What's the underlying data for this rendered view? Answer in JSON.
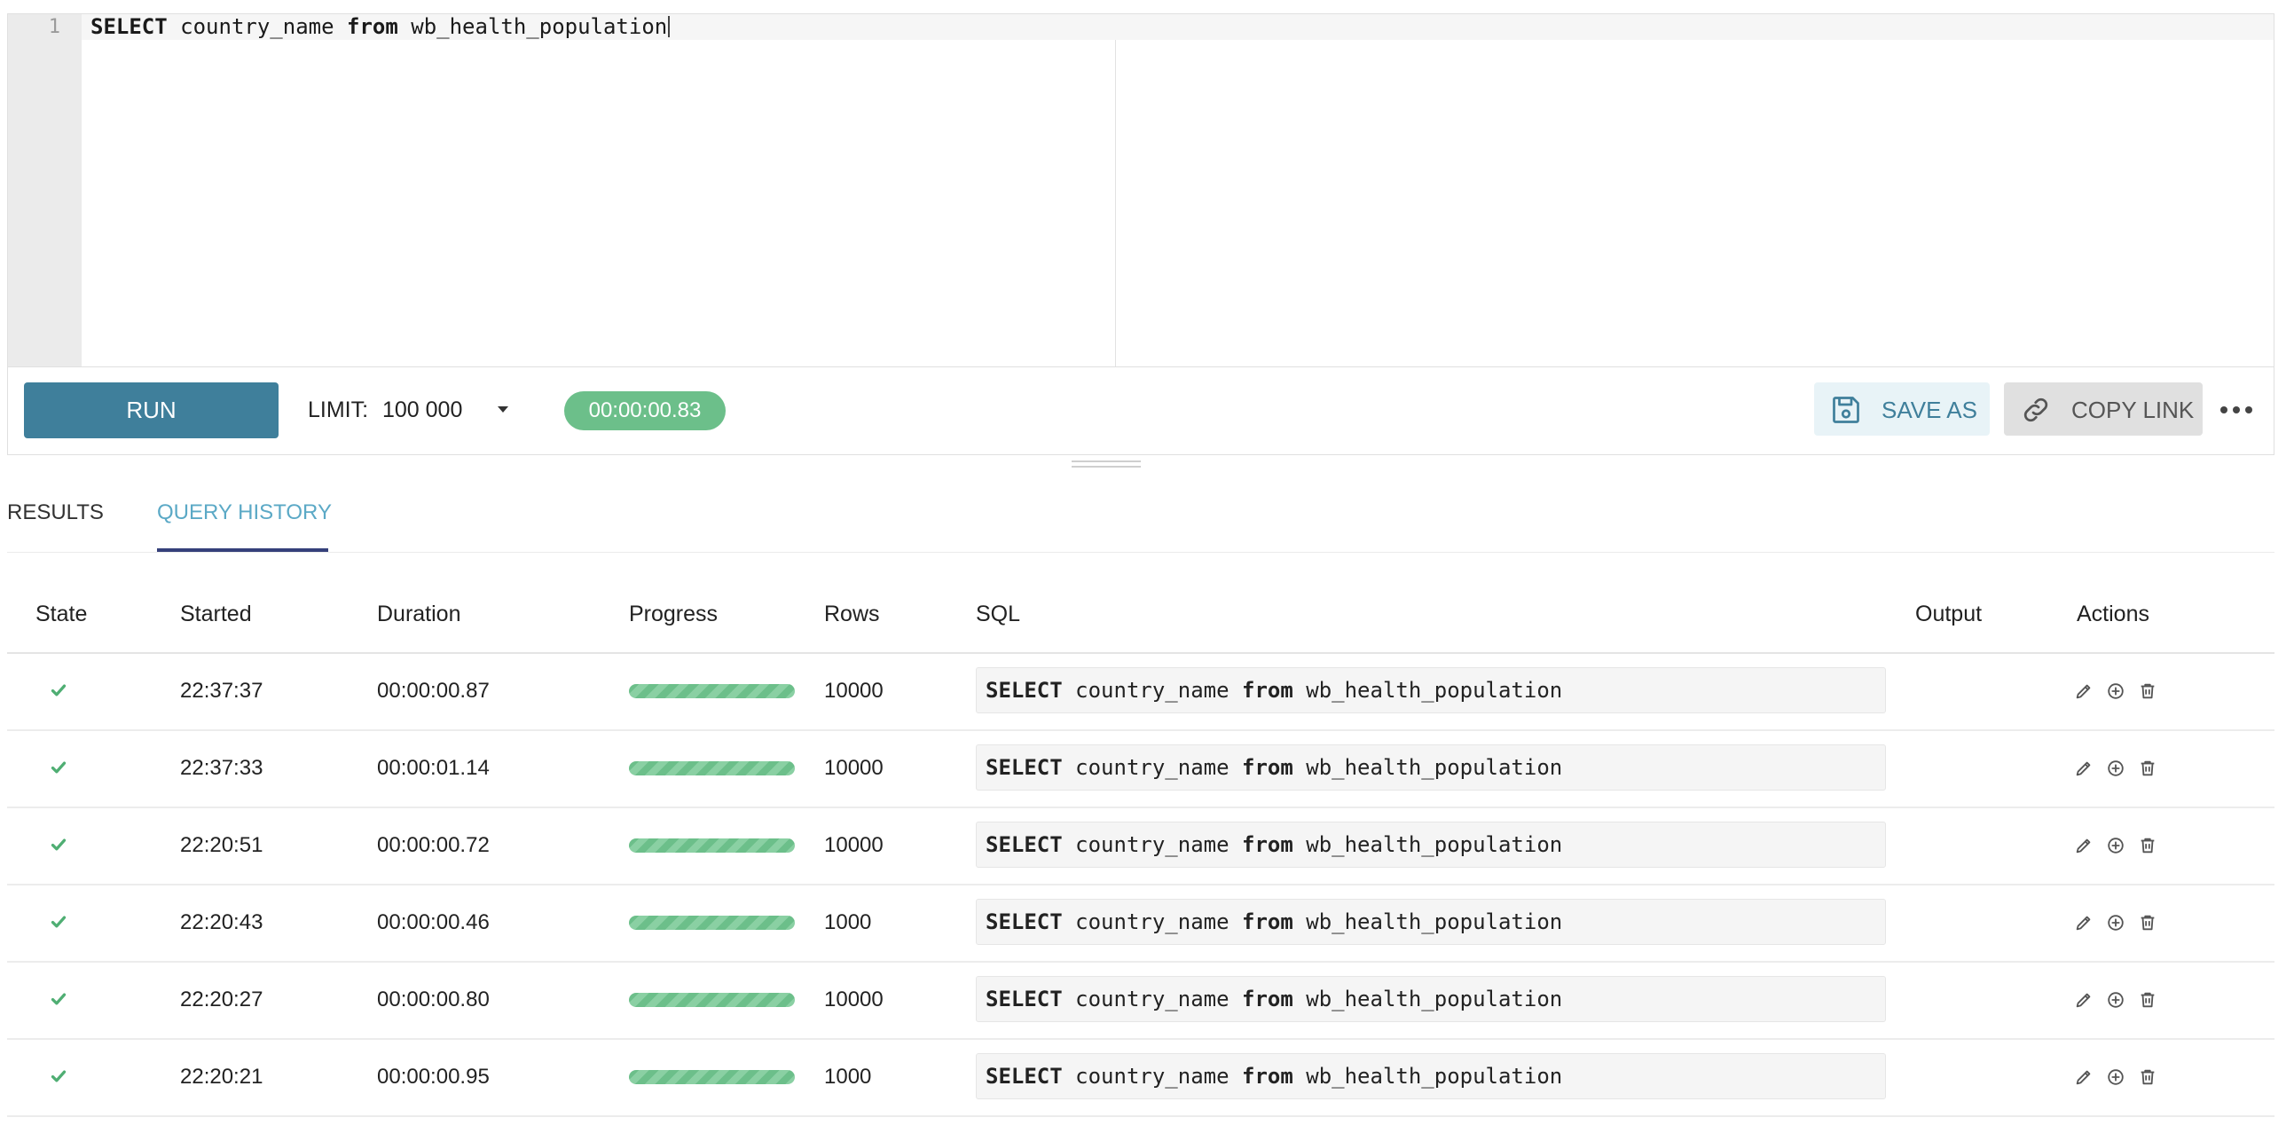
{
  "editor": {
    "line_number": "1",
    "sql_keyword_select": "SELECT",
    "sql_column": " country_name ",
    "sql_keyword_from": "from",
    "sql_table": " wb_health_population"
  },
  "toolbar": {
    "run_label": "RUN",
    "limit_label": "LIMIT:",
    "limit_value": "100 000",
    "timer": "00:00:00.83",
    "save_as_label": "SAVE AS",
    "copy_link_label": "COPY LINK",
    "icons": {
      "save": "floppy-disk-icon",
      "copy": "link-icon",
      "more": "ellipsis-icon"
    }
  },
  "tabs": [
    {
      "label": "RESULTS",
      "active": false
    },
    {
      "label": "QUERY HISTORY",
      "active": true
    }
  ],
  "table": {
    "headers": [
      "State",
      "Started",
      "Duration",
      "Progress",
      "Rows",
      "SQL",
      "Output",
      "Actions"
    ],
    "rows": [
      {
        "state": "success",
        "started": "22:37:37",
        "duration": "00:00:00.87",
        "progress": 1.0,
        "rows": "10000",
        "sql_select": "SELECT",
        "sql_mid": " country_name ",
        "sql_from": "from",
        "sql_table": " wb_health_population"
      },
      {
        "state": "success",
        "started": "22:37:33",
        "duration": "00:00:01.14",
        "progress": 1.0,
        "rows": "10000",
        "sql_select": "SELECT",
        "sql_mid": " country_name ",
        "sql_from": "from",
        "sql_table": " wb_health_population"
      },
      {
        "state": "success",
        "started": "22:20:51",
        "duration": "00:00:00.72",
        "progress": 1.0,
        "rows": "10000",
        "sql_select": "SELECT",
        "sql_mid": " country_name ",
        "sql_from": "from",
        "sql_table": " wb_health_population"
      },
      {
        "state": "success",
        "started": "22:20:43",
        "duration": "00:00:00.46",
        "progress": 1.0,
        "rows": "1000",
        "sql_select": "SELECT",
        "sql_mid": " country_name ",
        "sql_from": "from",
        "sql_table": " wb_health_population"
      },
      {
        "state": "success",
        "started": "22:20:27",
        "duration": "00:00:00.80",
        "progress": 1.0,
        "rows": "10000",
        "sql_select": "SELECT",
        "sql_mid": " country_name ",
        "sql_from": "from",
        "sql_table": " wb_health_population"
      },
      {
        "state": "success",
        "started": "22:20:21",
        "duration": "00:00:00.95",
        "progress": 1.0,
        "rows": "1000",
        "sql_select": "SELECT",
        "sql_mid": " country_name ",
        "sql_from": "from",
        "sql_table": " wb_health_population"
      }
    ],
    "action_icons": [
      "pencil-icon",
      "plus-circle-icon",
      "trash-icon"
    ]
  },
  "colors": {
    "primary": "#3f7f9b",
    "success": "#6cbf8a",
    "active_tab": "#5ba9c6",
    "tab_underline": "#35407a"
  }
}
